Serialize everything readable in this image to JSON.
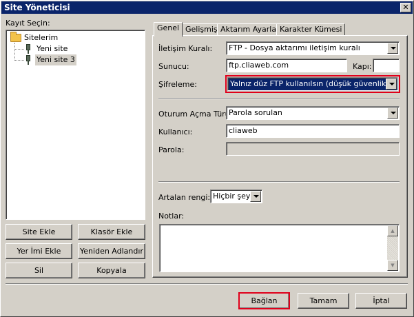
{
  "window": {
    "title": "Site Yöneticisi",
    "close_glyph": "✕"
  },
  "left": {
    "select_label": "Kayıt Seçin:",
    "tree": {
      "root": "Sitelerim",
      "children": [
        "Yeni site",
        "Yeni site 3"
      ]
    },
    "buttons": {
      "add_site": "Site Ekle",
      "add_folder": "Klasör Ekle",
      "bookmark_add": "Yer İmi Ekle",
      "rename": "Yeniden Adlandır",
      "delete": "Sil",
      "copy": "Kopyala"
    }
  },
  "tabs": [
    "Genel",
    "Gelişmiş",
    "Aktarım Ayarları",
    "Karakter Kümesi"
  ],
  "general": {
    "protocol_label": "İletişim Kuralı:",
    "protocol_value": "FTP - Dosya aktarımı iletişim kuralı",
    "host_label": "Sunucu:",
    "host_value": "ftp.cliaweb.com",
    "port_label": "Kapı:",
    "port_value": "",
    "encryption_label": "Şifreleme:",
    "encryption_value": "Yalnız düz FTP kullanılsın (düşük güvenlik)",
    "logon_label": "Oturum Açma Türü:",
    "logon_value": "Parola sorulan",
    "user_label": "Kullanıcı:",
    "user_value": "cliaweb",
    "password_label": "Parola:",
    "password_value": "",
    "bg_color_label": "Artalan rengi:",
    "bg_color_value": "Hiçbir şey",
    "notes_label": "Notlar:"
  },
  "footer": {
    "connect": "Bağlan",
    "ok": "Tamam",
    "cancel": "İptal"
  },
  "colors": {
    "titlebar": "#0a246a",
    "highlight_outline": "#e0001b",
    "face": "#d4d0c8"
  }
}
